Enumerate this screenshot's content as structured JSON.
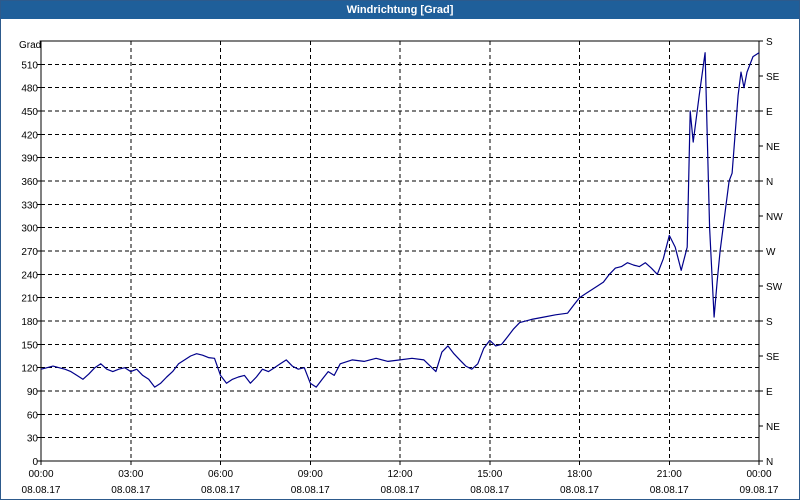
{
  "window": {
    "title": "Windrichtung [Grad]"
  },
  "chart_data": {
    "type": "line",
    "title": "Windrichtung [Grad]",
    "ylabel": "Grad",
    "ylim": [
      0,
      540
    ],
    "xlim_hours": [
      0,
      24
    ],
    "grid": true,
    "y_ticks": [
      0,
      30,
      60,
      90,
      120,
      150,
      180,
      210,
      240,
      270,
      300,
      330,
      360,
      390,
      420,
      450,
      480,
      510
    ],
    "right_axis": {
      "labels": [
        "N",
        "NE",
        "E",
        "SE",
        "S",
        "SW",
        "W",
        "NW",
        "N",
        "NE",
        "E",
        "SE",
        "S"
      ],
      "values": [
        0,
        45,
        90,
        135,
        180,
        225,
        270,
        315,
        360,
        405,
        450,
        495,
        540
      ]
    },
    "x_ticks": [
      {
        "hour": 0,
        "time": "00:00",
        "date": "08.08.17"
      },
      {
        "hour": 3,
        "time": "03:00",
        "date": "08.08.17"
      },
      {
        "hour": 6,
        "time": "06:00",
        "date": "08.08.17"
      },
      {
        "hour": 9,
        "time": "09:00",
        "date": "08.08.17"
      },
      {
        "hour": 12,
        "time": "12:00",
        "date": "08.08.17"
      },
      {
        "hour": 15,
        "time": "15:00",
        "date": "08.08.17"
      },
      {
        "hour": 18,
        "time": "18:00",
        "date": "08.08.17"
      },
      {
        "hour": 21,
        "time": "21:00",
        "date": "08.08.17"
      },
      {
        "hour": 24,
        "time": "00:00",
        "date": "09.08.17"
      }
    ],
    "series": [
      {
        "color": "#00008b",
        "hours": [
          0,
          0.2,
          0.4,
          0.6,
          0.8,
          1.0,
          1.2,
          1.4,
          1.6,
          1.8,
          2.0,
          2.2,
          2.4,
          2.6,
          2.8,
          3.0,
          3.2,
          3.4,
          3.6,
          3.8,
          4.0,
          4.2,
          4.4,
          4.6,
          4.8,
          5.0,
          5.2,
          5.4,
          5.6,
          5.8,
          6.0,
          6.2,
          6.4,
          6.6,
          6.8,
          7.0,
          7.2,
          7.4,
          7.6,
          7.8,
          8.0,
          8.2,
          8.4,
          8.6,
          8.8,
          9.0,
          9.2,
          9.4,
          9.6,
          9.8,
          10.0,
          10.4,
          10.8,
          11.2,
          11.6,
          12.0,
          12.4,
          12.8,
          13.2,
          13.4,
          13.6,
          13.8,
          14.0,
          14.2,
          14.4,
          14.6,
          14.8,
          15.0,
          15.2,
          15.4,
          15.6,
          15.8,
          16.0,
          16.4,
          16.8,
          17.2,
          17.6,
          17.8,
          18.0,
          18.2,
          18.4,
          18.6,
          18.8,
          19.0,
          19.2,
          19.4,
          19.6,
          19.8,
          20.0,
          20.2,
          20.4,
          20.6,
          20.8,
          21.0,
          21.2,
          21.4,
          21.6,
          21.7,
          21.8,
          22.0,
          22.2,
          22.35,
          22.5,
          22.6,
          22.7,
          22.9,
          23.0,
          23.1,
          23.2,
          23.3,
          23.4,
          23.5,
          23.6,
          23.8,
          24.0
        ],
        "values": [
          118,
          120,
          122,
          120,
          118,
          115,
          110,
          105,
          112,
          120,
          125,
          118,
          115,
          118,
          120,
          115,
          118,
          110,
          105,
          95,
          100,
          108,
          115,
          125,
          130,
          135,
          138,
          136,
          133,
          132,
          110,
          100,
          105,
          108,
          110,
          100,
          108,
          118,
          115,
          120,
          125,
          130,
          122,
          118,
          120,
          100,
          95,
          105,
          115,
          110,
          125,
          130,
          128,
          132,
          128,
          130,
          132,
          130,
          115,
          140,
          148,
          138,
          130,
          122,
          118,
          125,
          145,
          155,
          148,
          150,
          160,
          170,
          178,
          182,
          185,
          188,
          190,
          200,
          210,
          215,
          220,
          225,
          230,
          240,
          248,
          250,
          255,
          252,
          250,
          255,
          248,
          240,
          260,
          290,
          275,
          245,
          275,
          450,
          410,
          470,
          525,
          300,
          185,
          230,
          270,
          330,
          360,
          370,
          420,
          470,
          500,
          480,
          500,
          520,
          525
        ]
      }
    ]
  }
}
